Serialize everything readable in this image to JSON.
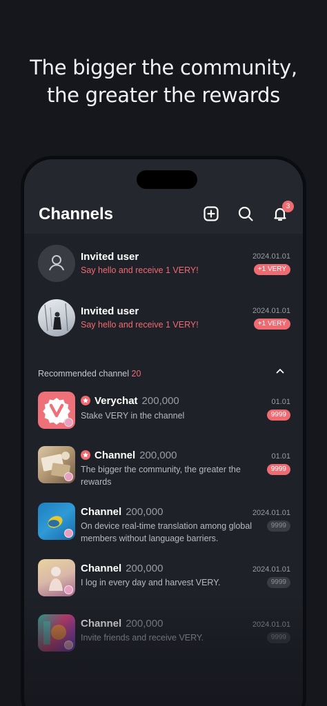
{
  "headline": {
    "line1": "The bigger the community,",
    "line2": "the greater the rewards"
  },
  "appbar": {
    "title": "Channels",
    "notification_count": "3",
    "icons": [
      "add-square-icon",
      "search-icon",
      "bell-icon"
    ]
  },
  "invites": [
    {
      "title": "Invited user",
      "subtitle": "Say hello and receive 1 VERY!",
      "date": "2024.01.01",
      "reward": "+1 VERY",
      "avatar": "default-person"
    },
    {
      "title": "Invited user",
      "subtitle": "Say hello and receive 1 VERY!",
      "date": "2024.01.01",
      "reward": "+1 VERY",
      "avatar": "photo-snow"
    }
  ],
  "recommended": {
    "label": "Recommended channel",
    "count": "20"
  },
  "channels": [
    {
      "name": "Verychat",
      "members": "200,000",
      "desc": "Stake VERY in the channel",
      "date": "01.01",
      "badge": "9999",
      "starred": true,
      "badge_active": true
    },
    {
      "name": "Channel",
      "members": "200,000",
      "desc": "The bigger the community, the greater the rewards",
      "date": "01.01",
      "badge": "9999",
      "starred": true,
      "badge_active": true
    },
    {
      "name": "Channel",
      "members": "200,000",
      "desc": "On device real-time translation among global members without language barriers.",
      "date": "2024.01.01",
      "badge": "9999",
      "starred": false,
      "badge_active": false
    },
    {
      "name": "Channel",
      "members": "200,000",
      "desc": "I log in every day and harvest VERY.",
      "date": "2024.01.01",
      "badge": "9999",
      "starred": false,
      "badge_active": false
    },
    {
      "name": "Channel",
      "members": "200,000",
      "desc": "Invite friends and receive VERY.",
      "date": "2024.01.01",
      "badge": "9999",
      "starred": false,
      "badge_active": false
    }
  ],
  "colors": {
    "accent": "#ef6b72",
    "background": "#15171d",
    "screen": "#1f2128"
  }
}
